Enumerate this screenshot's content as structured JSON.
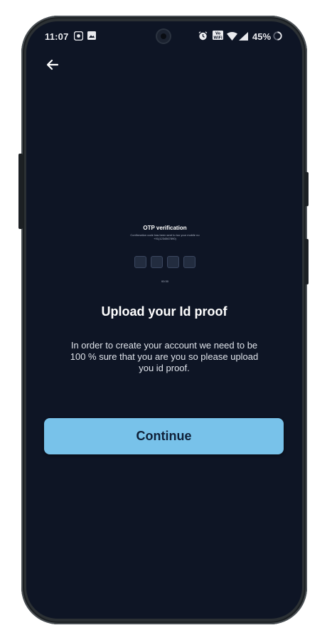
{
  "status_bar": {
    "time": "11:07",
    "battery_percent": "45%",
    "icons": [
      "notification-icon",
      "gallery-icon",
      "alarm-icon",
      "vowifi-icon",
      "wifi-icon",
      "signal-icon",
      "battery-icon"
    ]
  },
  "otp_preview": {
    "title": "OTP verification",
    "subtitle": "Confirmation code has been sent to too your mobile no +91(1234567890)",
    "box_count": 4,
    "timer": "00:30"
  },
  "main": {
    "title": "Upload your Id proof",
    "description": "In order to create your account we need to be 100 % sure that you are you so please upload you id proof.",
    "continue_label": "Continue"
  },
  "colors": {
    "background": "#0e1525",
    "accent_button": "#78c2ea",
    "button_text": "#0f2038"
  }
}
